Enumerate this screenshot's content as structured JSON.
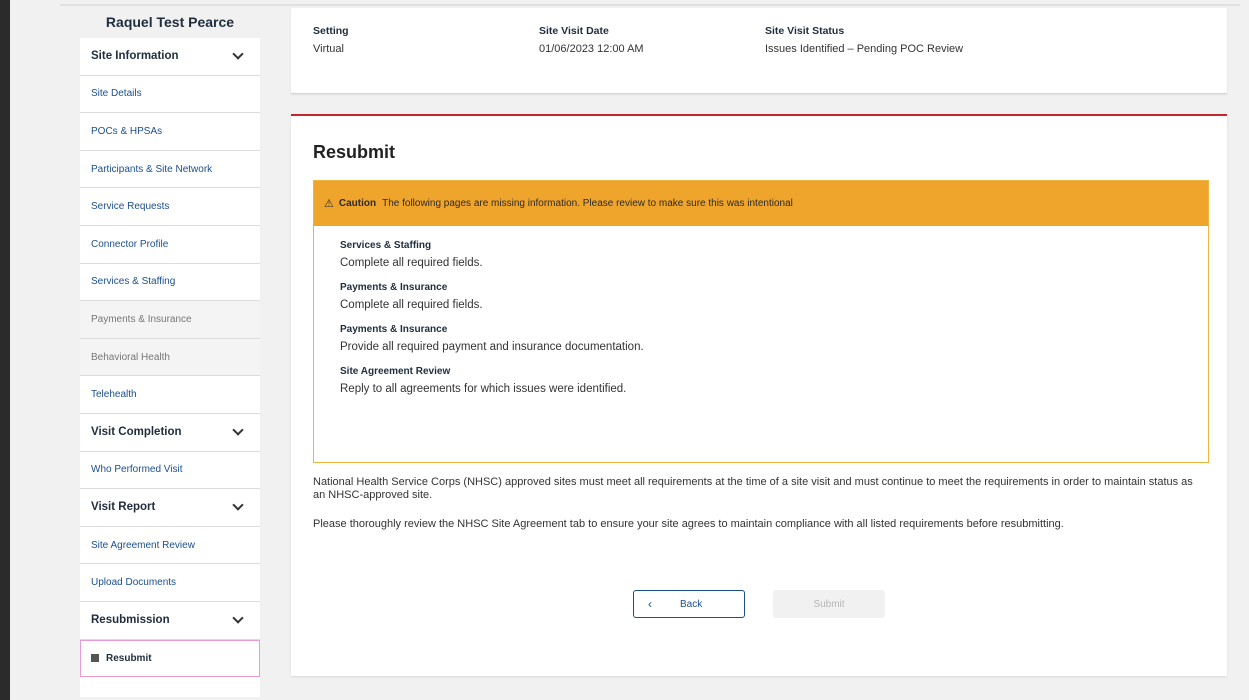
{
  "sidebar": {
    "user_name": "Raquel Test Pearce",
    "site_information": "Site Information",
    "site_details": "Site Details",
    "pocs_hpsas": "POCs & HPSAs",
    "participants": "Participants & Site Network",
    "service_requests": "Service Requests",
    "connector_profile": "Connector Profile",
    "services_staffing": "Services & Staffing",
    "payments_insurance": "Payments & Insurance",
    "behavioral_health": "Behavioral Health",
    "telehealth": "Telehealth",
    "visit_completion": "Visit Completion",
    "who_performed": "Who Performed Visit",
    "visit_report": "Visit Report",
    "site_agreement_review": "Site Agreement Review",
    "upload_documents": "Upload Documents",
    "resubmission": "Resubmission",
    "resubmit": "Resubmit"
  },
  "info": {
    "setting_label": "Setting",
    "setting_value": "Virtual",
    "date_label": "Site Visit Date",
    "date_value": "01/06/2023 12:00 AM",
    "status_label": "Site Visit Status",
    "status_value": "Issues Identified – Pending POC Review"
  },
  "main": {
    "title": "Resubmit",
    "caution": {
      "icon": "warning-icon",
      "label": "Caution",
      "text": "The following pages are missing information. Please review to make sure this was intentional",
      "issues": [
        {
          "title": "Services & Staffing",
          "message": "Complete all required fields."
        },
        {
          "title": "Payments & Insurance",
          "message": "Complete all required fields."
        },
        {
          "title": "Payments & Insurance",
          "message": "Provide all required payment and insurance documentation."
        },
        {
          "title": "Site Agreement Review",
          "message": "Reply to all agreements for which issues were identified."
        }
      ]
    },
    "para1": "National Health Service Corps (NHSC) approved sites must meet all requirements at the time of a site visit and must continue to meet the requirements in order to maintain status as an NHSC-approved site.",
    "para2": "Please thoroughly review the NHSC Site Agreement tab to ensure your site agrees to maintain compliance with all listed requirements before resubmitting.",
    "back_label": "Back",
    "submit_label": "Submit"
  },
  "colors": {
    "accent_red": "#c0282d",
    "caution_orange": "#efa52b",
    "link_blue": "#1b4f8c"
  }
}
